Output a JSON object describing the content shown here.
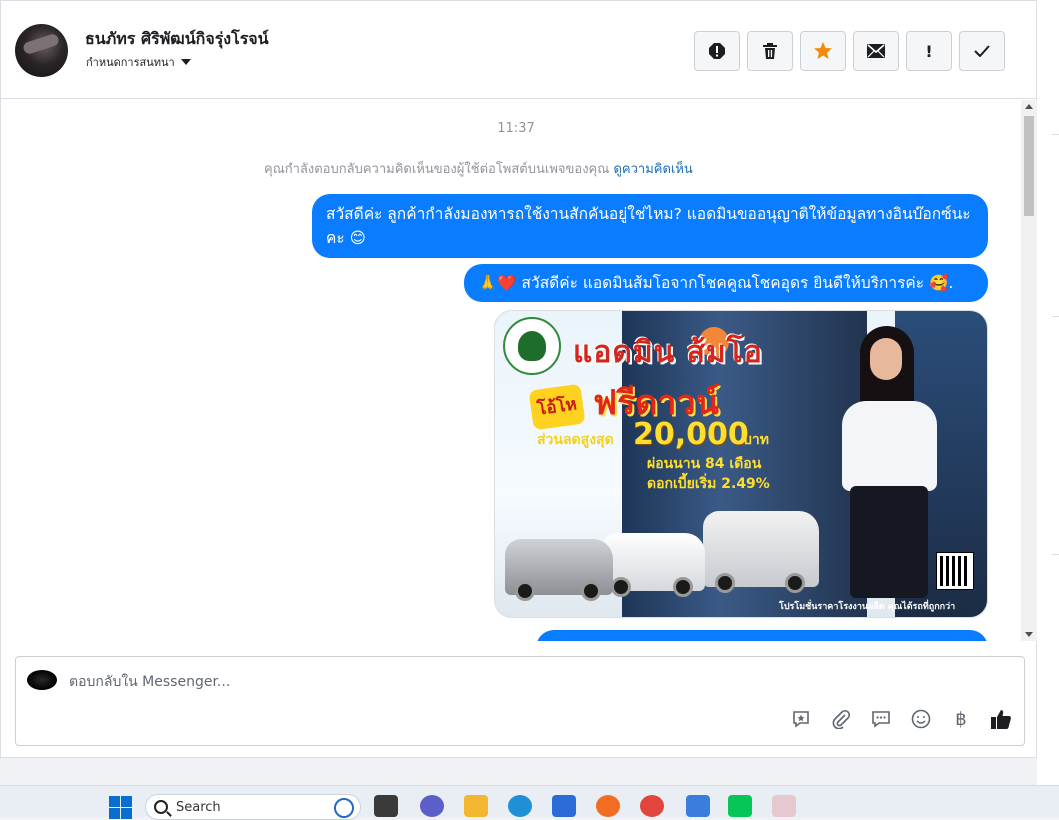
{
  "header": {
    "contact_name": "ธนภัทร ศิริพัฒน์กิจรุ่งโรจน์",
    "assign_label": "กำหนดการสนทนา",
    "tools": [
      {
        "name": "report-spam-icon",
        "glyph": "!"
      },
      {
        "name": "trash-icon",
        "glyph": "🗑"
      },
      {
        "name": "star-icon",
        "glyph": "★"
      },
      {
        "name": "mail-icon",
        "glyph": "✉"
      },
      {
        "name": "priority-icon",
        "glyph": "!"
      },
      {
        "name": "checkmark-icon",
        "glyph": "✓"
      }
    ]
  },
  "conversation": {
    "timestamp": "11:37",
    "notice_text": "คุณกำลังตอบกลับความคิดเห็นของผู้ใช้ต่อโพสต์บนเพจของคุณ ",
    "notice_link": "ดูความคิดเห็น",
    "messages": [
      {
        "type": "text",
        "text": "สวัสดีค่ะ ลูกค้ากำลังมองหารถใช้งานสักคันอยู่ใช่ไหม? แอดมินขออนุญาติให้ข้อมูลทางอินบ๊อกซ์นะคะ 😊"
      },
      {
        "type": "text",
        "text": "🙏❤️ สวัสดีค่ะ แอดมินส้มโอจากโชคคูณโชคอุดร ยินดีให้บริการค่ะ 🥰."
      },
      {
        "type": "image",
        "alt": "โปรโมชั่น"
      }
    ],
    "promo": {
      "title": "แอดมิน  ส้มโอ",
      "badge": "โอ้โห",
      "headline": "ฟรีดาวน์",
      "discount_label": "ส่วนลดสูงสุด",
      "amount": "20,000",
      "currency": "บาท",
      "installment": "ผ่อนนาน 84 เดือน",
      "interest": "ดอกเบี้ยเริ่ม 2.49%",
      "footer": "โปรโมชั่นราคาโรงงานผลิต คุณได้รถที่ถูกกว่า"
    }
  },
  "composer": {
    "placeholder": "ตอบกลับใน Messenger...",
    "tools": [
      {
        "name": "saved-reply-icon",
        "glyph": "✪"
      },
      {
        "name": "attachment-icon",
        "glyph": "📎"
      },
      {
        "name": "quick-reply-icon",
        "glyph": "💬"
      },
      {
        "name": "emoji-icon",
        "glyph": "☺"
      },
      {
        "name": "payment-icon",
        "glyph": "฿"
      },
      {
        "name": "like-icon",
        "glyph": "👍"
      }
    ]
  },
  "taskbar": {
    "search_label": "Search"
  }
}
